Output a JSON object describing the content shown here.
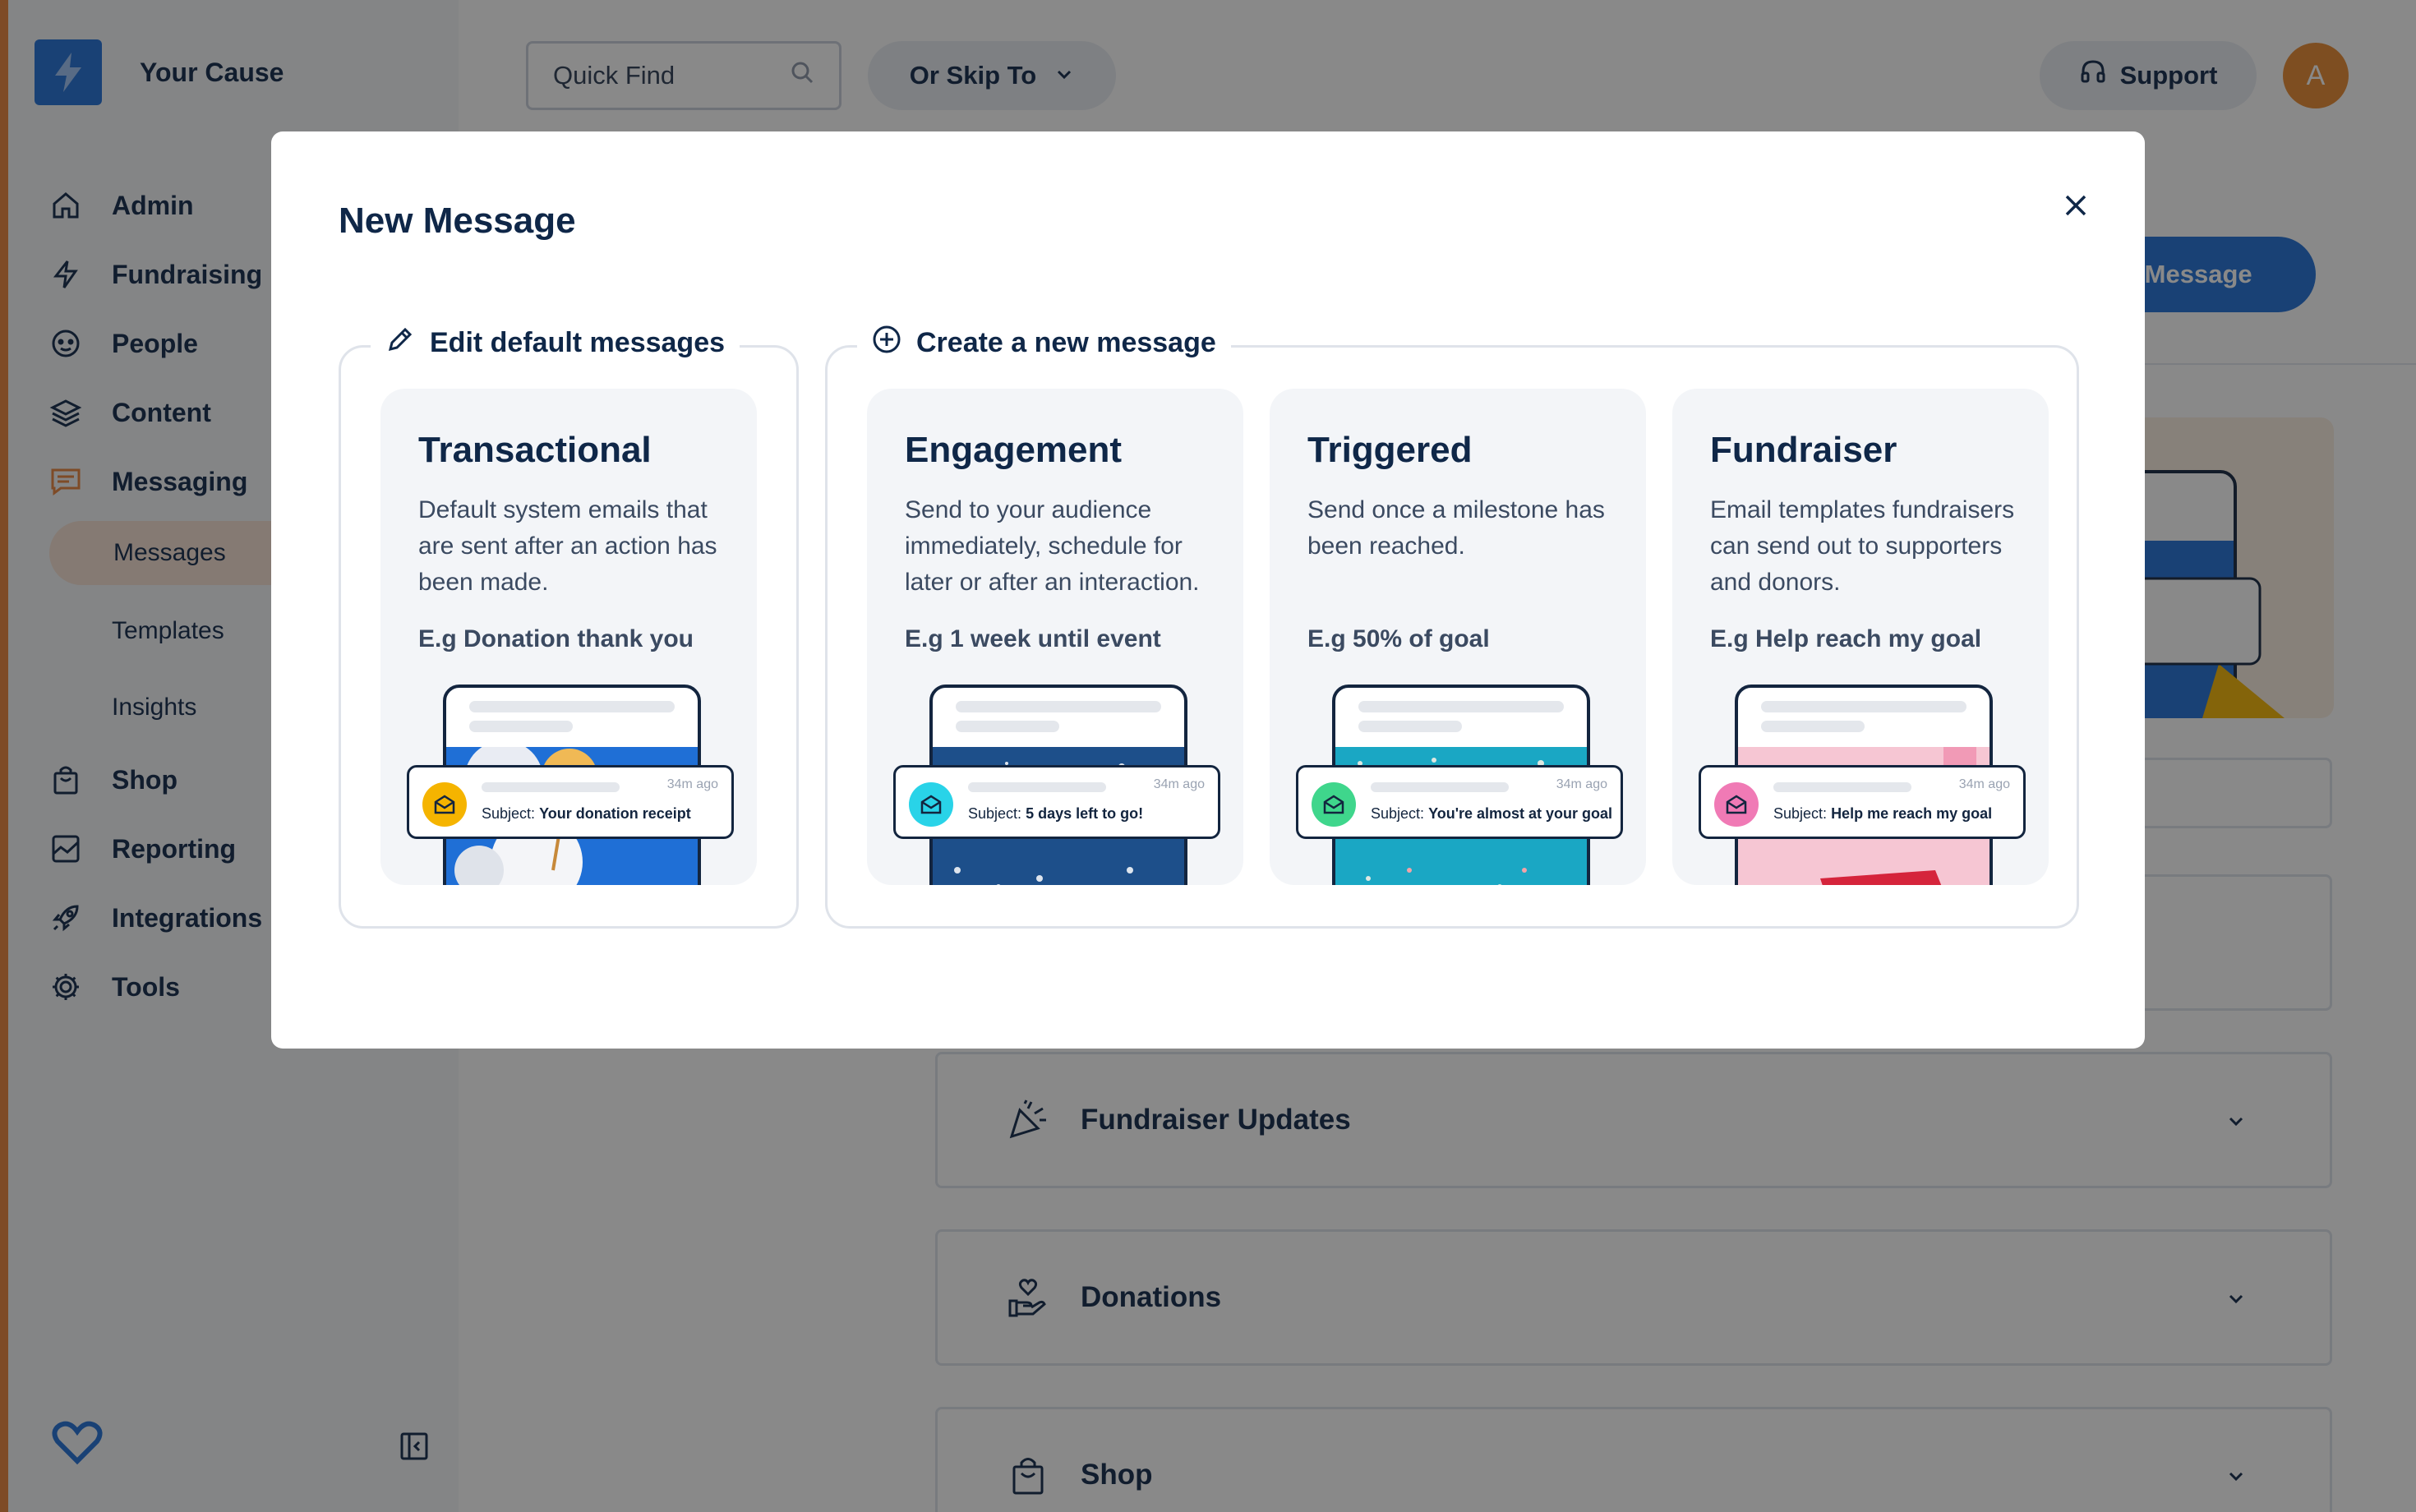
{
  "app": {
    "brand_name": "Your Cause",
    "search_placeholder": "Quick Find",
    "skip_label": "Or Skip To",
    "support_label": "Support",
    "avatar_initial": "A",
    "new_message_button": "New Message",
    "nav": [
      {
        "label": "Admin",
        "icon": "home-icon"
      },
      {
        "label": "Fundraising",
        "icon": "lightning-icon"
      },
      {
        "label": "People",
        "icon": "face-icon"
      },
      {
        "label": "Content",
        "icon": "layers-icon"
      },
      {
        "label": "Messaging",
        "icon": "chat-icon"
      }
    ],
    "messaging_sub": [
      "Messages",
      "Templates",
      "Insights"
    ],
    "nav_bottom": [
      {
        "label": "Shop",
        "icon": "bag-icon"
      },
      {
        "label": "Reporting",
        "icon": "chart-icon"
      },
      {
        "label": "Integrations",
        "icon": "rocket-icon"
      },
      {
        "label": "Tools",
        "icon": "gear-icon"
      }
    ],
    "accordions": [
      {
        "label": "Fundraiser Updates",
        "icon": "party-popper-icon"
      },
      {
        "label": "Donations",
        "icon": "hand-heart-icon"
      },
      {
        "label": "Shop",
        "icon": "bag-icon"
      }
    ],
    "accent_color": "#1f6fd6",
    "sidebar_accent": "#e8833a"
  },
  "modal": {
    "title": "New Message",
    "group_default": {
      "legend": "Edit default messages",
      "icon": "pencil-icon"
    },
    "group_new": {
      "legend": "Create a new message",
      "icon": "plus-circle-icon"
    },
    "notif_time": "34m ago",
    "subject_prefix": "Subject:",
    "cards": [
      {
        "title": "Transactional",
        "description": "Default system emails that are sent after an action has been made.",
        "example": "E.g Donation thank you",
        "subject": "Your donation receipt",
        "dot_color": "#f5b400"
      },
      {
        "title": "Engagement",
        "description": "Send to your audience immediately, schedule for later or after an interaction.",
        "example": "E.g 1 week until event",
        "subject": "5 days left to go!",
        "dot_color": "#29d3e8"
      },
      {
        "title": "Triggered",
        "description": "Send once a milestone has been reached.",
        "example": "E.g 50% of goal",
        "subject": "You're almost at your goal",
        "dot_color": "#3fd68c"
      },
      {
        "title": "Fundraiser",
        "description": "Email templates fundraisers can send out to supporters and donors.",
        "example": "E.g Help reach my goal",
        "subject": "Help me reach my goal",
        "dot_color": "#f07ab5"
      }
    ]
  }
}
